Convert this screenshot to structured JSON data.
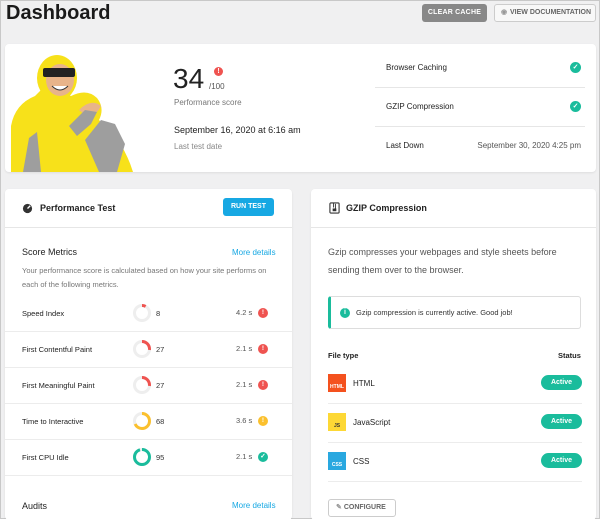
{
  "header": {
    "title": "Dashboard",
    "clear_cache": "CLEAR CACHE",
    "view_docs": "VIEW DOCUMENTATION"
  },
  "summary": {
    "score": "34",
    "score_denom": "/100",
    "score_label": "Performance score",
    "test_date": "September 16, 2020 at 6:16 am",
    "test_date_label": "Last test date",
    "right_rows": [
      {
        "label": "Browser Caching",
        "status": "ok"
      },
      {
        "label": "GZIP Compression",
        "status": "ok"
      },
      {
        "label": "Last Down",
        "value": "September 30, 2020 4:25 pm"
      }
    ]
  },
  "performance": {
    "title": "Performance Test",
    "run_test": "RUN TEST",
    "score_metrics_title": "Score Metrics",
    "more_details": "More details",
    "description": "Your performance score is calculated based on how your site performs on each of the following metrics.",
    "metrics": [
      {
        "name": "Speed Index",
        "score": 8,
        "time": "4.2 s",
        "status": "bad"
      },
      {
        "name": "First Contentful Paint",
        "score": 27,
        "time": "2.1 s",
        "status": "bad"
      },
      {
        "name": "First Meaningful Paint",
        "score": 27,
        "time": "2.1 s",
        "status": "bad"
      },
      {
        "name": "Time to Interactive",
        "score": 68,
        "time": "3.6 s",
        "status": "warn"
      },
      {
        "name": "First CPU Idle",
        "score": 95,
        "time": "2.1 s",
        "status": "good"
      }
    ],
    "audits_title": "Audits",
    "audits_more": "More details"
  },
  "gzip": {
    "title": "GZIP Compression",
    "description": "Gzip compresses your webpages and style sheets before sending them over to the browser.",
    "notice": "Gzip compression is currently active. Good job!",
    "col_filetype": "File type",
    "col_status": "Status",
    "files": [
      {
        "name": "HTML",
        "icon": "HTML",
        "color": "#f4511e",
        "status": "Active"
      },
      {
        "name": "JavaScript",
        "icon": "JS",
        "color": "#fdd835",
        "status": "Active"
      },
      {
        "name": "CSS",
        "icon": "CSS",
        "color": "#29a8e0",
        "status": "Active"
      }
    ],
    "configure": "CONFIGURE"
  },
  "colors": {
    "good": "#1abc9c",
    "warn": "#fbc02d",
    "bad": "#ef5350",
    "accent": "#17a8e3"
  }
}
